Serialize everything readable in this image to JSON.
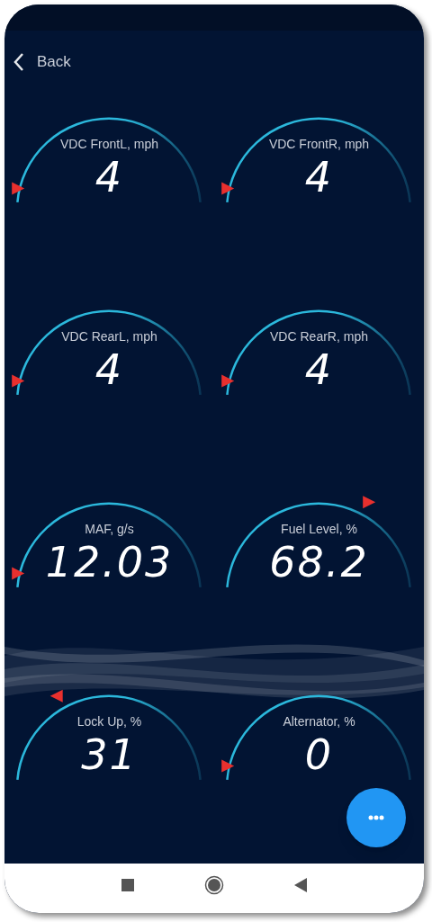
{
  "header": {
    "back_label": "Back"
  },
  "gauges": [
    {
      "label": "VDC FrontL, mph",
      "value": "4"
    },
    {
      "label": "VDC FrontR, mph",
      "value": "4"
    },
    {
      "label": "VDC RearL, mph",
      "value": "4"
    },
    {
      "label": "VDC RearR, mph",
      "value": "4"
    },
    {
      "label": "MAF, g/s",
      "value": "12.03"
    },
    {
      "label": "Fuel Level, %",
      "value": "68.2"
    },
    {
      "label": "Lock Up, %",
      "value": "31"
    },
    {
      "label": "Alternator, %",
      "value": "0"
    }
  ]
}
